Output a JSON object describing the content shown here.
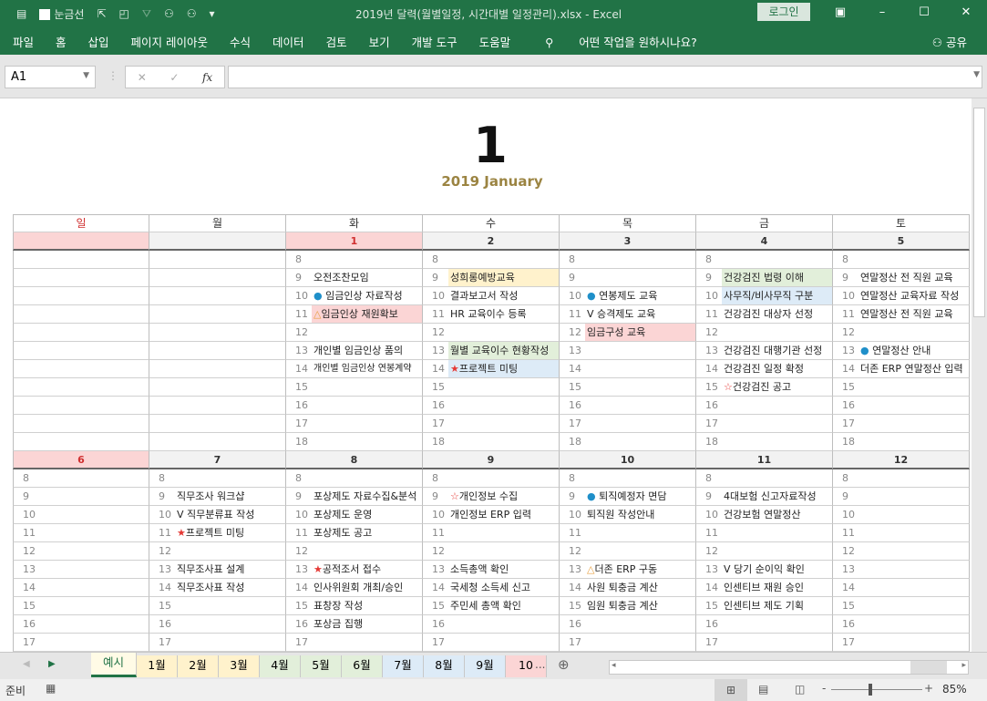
{
  "titlebar": {
    "gridlines_label": "눈금선",
    "title": "2019년 달력(월별일정, 시간대별 일정관리).xlsx  -  Excel",
    "login": "로그인"
  },
  "ribbon": {
    "tabs": [
      "파일",
      "홈",
      "삽입",
      "페이지 레이아웃",
      "수식",
      "데이터",
      "검토",
      "보기",
      "개발 도구",
      "도움말"
    ],
    "search": "어떤 작업을 원하시나요?",
    "share": "공유"
  },
  "formula": {
    "namebox": "A1",
    "value": ""
  },
  "calendar": {
    "month_number": "1",
    "subtitle": "2019 January",
    "weekdays": [
      "일",
      "월",
      "화",
      "수",
      "목",
      "금",
      "토"
    ],
    "hours": [
      "8",
      "9",
      "10",
      "11",
      "12",
      "13",
      "14",
      "15",
      "16",
      "17",
      "18"
    ],
    "weeks": [
      {
        "days": [
          {
            "date": "",
            "red": true,
            "hours": false,
            "events": {}
          },
          {
            "date": "",
            "hours": false,
            "events": {}
          },
          {
            "date": "1",
            "red": true,
            "events": {
              "9": {
                "t": "오전조찬모임"
              },
              "10": {
                "t": "임금인상 자료작성",
                "i": "dot"
              },
              "11": {
                "t": "임금인상 재원확보",
                "i": "tri",
                "bg": "pink"
              },
              "13": {
                "t": "개인별 임금인상 품의"
              },
              "14": {
                "t": "개인별 임금인상 연봉계약",
                "small": true
              }
            }
          },
          {
            "date": "2",
            "events": {
              "9": {
                "t": "성희롱예방교육",
                "bg": "yellow"
              },
              "10": {
                "t": "결과보고서 작성"
              },
              "11": {
                "t": "HR 교육이수 등록"
              },
              "13": {
                "t": "월별 교육이수 현황작성",
                "bg": "green"
              },
              "14": {
                "t": "프로젝트 미팅",
                "i": "star",
                "bg": "blue"
              }
            }
          },
          {
            "date": "3",
            "events": {
              "10": {
                "t": "연봉제도 교육",
                "i": "dot"
              },
              "11": {
                "t": "V 승격제도 교육"
              },
              "12": {
                "t": "임금구성 교육",
                "bg": "pink"
              }
            }
          },
          {
            "date": "4",
            "events": {
              "9": {
                "t": "건강검진 법령 이해",
                "bg": "green"
              },
              "10": {
                "t": "사무직/비사무직 구분",
                "bg": "blue"
              },
              "11": {
                "t": "건강검진 대상자 선정"
              },
              "13": {
                "t": "건강검진 대행기관 선정"
              },
              "14": {
                "t": "건강검진 일정 확정"
              },
              "15": {
                "t": "건강검진 공고",
                "i": "ostar"
              }
            }
          },
          {
            "date": "5",
            "events": {
              "9": {
                "t": "연말정산 전 직원 교육"
              },
              "10": {
                "t": "연말정산 교육자료 작성"
              },
              "11": {
                "t": "연말정산 전 직원 교육"
              },
              "13": {
                "t": "연말정산 안내",
                "i": "dot"
              },
              "14": {
                "t": "더존 ERP 연말정산 입력"
              }
            }
          }
        ]
      },
      {
        "days": [
          {
            "date": "6",
            "red": true,
            "events": {}
          },
          {
            "date": "7",
            "events": {
              "9": {
                "t": "직무조사 워크샵"
              },
              "10": {
                "t": "V 직무분류표 작성"
              },
              "11": {
                "t": "프로젝트 미팅",
                "i": "star"
              },
              "13": {
                "t": "직무조사표 설계"
              },
              "14": {
                "t": "직무조사표 작성"
              }
            }
          },
          {
            "date": "8",
            "events": {
              "9": {
                "t": "포상제도 자료수집&분석"
              },
              "10": {
                "t": "포상제도 운영"
              },
              "11": {
                "t": "포상제도 공고"
              },
              "13": {
                "t": "공적조서 접수",
                "i": "star"
              },
              "14": {
                "t": "인사위원회 개최/승인"
              },
              "15": {
                "t": "표창장 작성"
              },
              "16": {
                "t": "포상금 집행"
              }
            }
          },
          {
            "date": "9",
            "events": {
              "9": {
                "t": "개인정보 수집",
                "i": "ostar"
              },
              "10": {
                "t": "개인정보 ERP 입력"
              },
              "13": {
                "t": "소득총액 확인"
              },
              "14": {
                "t": "국세청 소득세 신고"
              },
              "15": {
                "t": "주민세 총액 확인"
              }
            }
          },
          {
            "date": "10",
            "events": {
              "9": {
                "t": "퇴직예정자 면담",
                "i": "dot"
              },
              "10": {
                "t": "퇴직원 작성안내"
              },
              "13": {
                "t": "더존 ERP 구동",
                "i": "tri"
              },
              "14": {
                "t": "사원 퇴충금 계산"
              },
              "15": {
                "t": "임원 퇴충금 계산"
              }
            }
          },
          {
            "date": "11",
            "events": {
              "9": {
                "t": "4대보험 신고자료작성"
              },
              "10": {
                "t": "건강보험 연말정산"
              },
              "13": {
                "t": "V 당기 순이익 확인"
              },
              "14": {
                "t": "인센티브 재원 승인"
              },
              "15": {
                "t": "인센티브 제도 기획"
              }
            }
          },
          {
            "date": "12",
            "events": {}
          }
        ]
      }
    ]
  },
  "colors": {
    "yellow": "#fff2cc",
    "green": "#e2efda",
    "blue": "#ddebf7",
    "pink": "#fbd5d5",
    "dot": "#1f8fc9",
    "star": "#e53935",
    "tri": "#e8a040"
  },
  "sheet_tabs": [
    {
      "label": "예시",
      "color": "#fffbe6",
      "active": true
    },
    {
      "label": "1월",
      "color": "#fff2cc"
    },
    {
      "label": "2월",
      "color": "#fff2cc"
    },
    {
      "label": "3월",
      "color": "#fff2cc"
    },
    {
      "label": "4월",
      "color": "#e2efda"
    },
    {
      "label": "5월",
      "color": "#e2efda"
    },
    {
      "label": "6월",
      "color": "#e2efda"
    },
    {
      "label": "7월",
      "color": "#ddebf7"
    },
    {
      "label": "8월",
      "color": "#ddebf7"
    },
    {
      "label": "9월",
      "color": "#ddebf7"
    },
    {
      "label": "10",
      "color": "#fbd5d5"
    }
  ],
  "tabs_more": "...",
  "status": {
    "ready": "준비",
    "zoom": "85%"
  }
}
